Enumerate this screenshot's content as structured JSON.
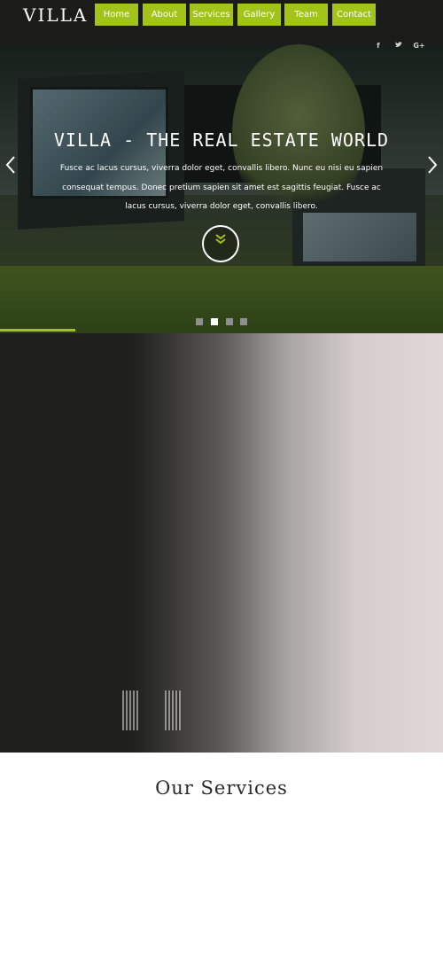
{
  "header": {
    "logo": "VILLA",
    "nav": [
      "Home",
      "About",
      "Services",
      "Gallery",
      "Team",
      "Contact"
    ],
    "social": [
      "f",
      "t",
      "G+"
    ]
  },
  "hero": {
    "title": "VILLA - THE REAL ESTATE WORLD",
    "text": "Fusce ac lacus cursus, viverra dolor eget, convallis libero. Nunc eu nisi eu sapien consequat tempus. Donec pretium sapien sit amet est sagittis feugiat. Fusce ac lacus cursus, viverra dolor eget, convallis libero.",
    "prev_icon": "chevron-left-icon",
    "next_icon": "chevron-right-icon",
    "down_icon": "double-chevron-down-icon",
    "slides_total": 4,
    "active_slide": 2,
    "progress": 0.17
  },
  "services": {
    "title": "Our Services"
  },
  "colors": {
    "accent": "#a2c31a",
    "header_bg": "#1b1c1a"
  }
}
